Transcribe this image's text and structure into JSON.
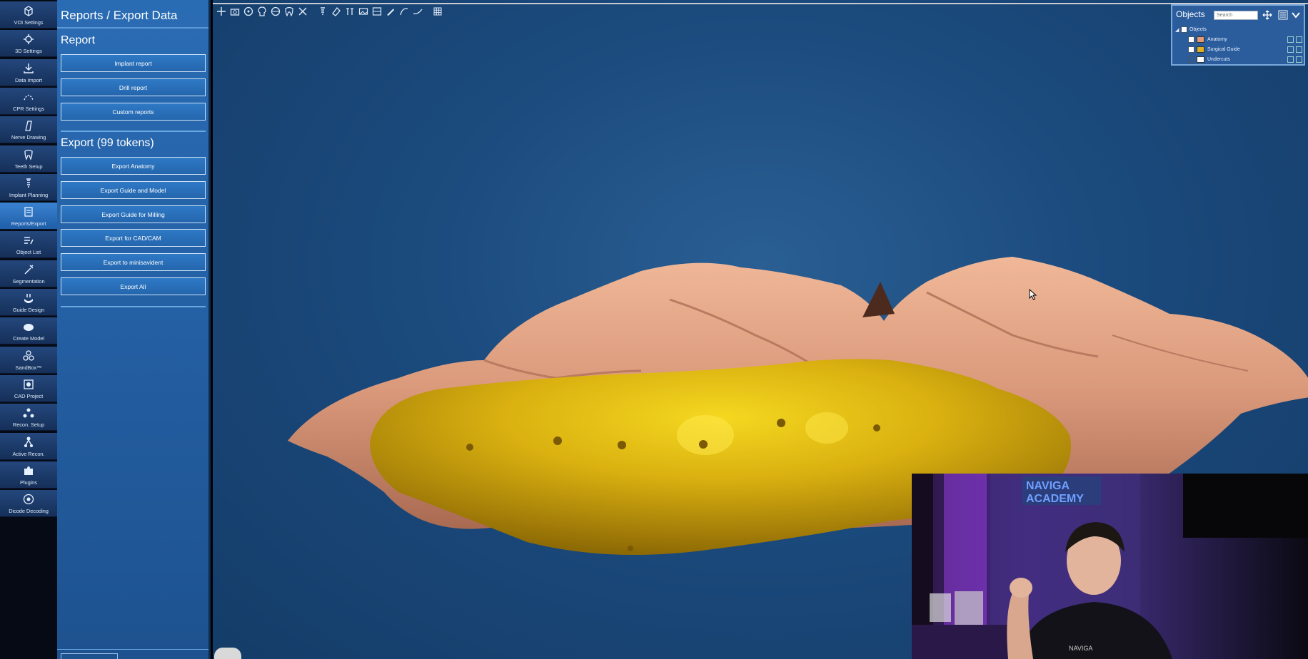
{
  "rail": {
    "items": [
      {
        "label": "VOI Settings",
        "icon": "voi-cube-icon"
      },
      {
        "label": "3D Settings",
        "icon": "3d-settings-icon"
      },
      {
        "label": "Data Import",
        "icon": "download-icon"
      },
      {
        "label": "CPR Settings",
        "icon": "cpr-curve-icon"
      },
      {
        "label": "Nerve Drawing",
        "icon": "nerve-drawing-icon"
      },
      {
        "label": "Teeth Setup",
        "icon": "tooth-icon"
      },
      {
        "label": "Implant Planning",
        "icon": "implant-icon"
      },
      {
        "label": "Reports/Export",
        "icon": "report-icon"
      },
      {
        "label": "Object List",
        "icon": "list-edit-icon"
      },
      {
        "label": "Segmentation",
        "icon": "wand-icon"
      },
      {
        "label": "Guide Design",
        "icon": "guide-icon"
      },
      {
        "label": "Create Model",
        "icon": "model-icon"
      },
      {
        "label": "SandBox™",
        "icon": "sandbox-icon"
      },
      {
        "label": "CAD Project",
        "icon": "cad-icon"
      },
      {
        "label": "Recon. Setup",
        "icon": "recon-setup-icon"
      },
      {
        "label": "Active Recon.",
        "icon": "active-recon-icon"
      },
      {
        "label": "Plugins",
        "icon": "puzzle-icon"
      },
      {
        "label": "Dicode Decoding",
        "icon": "decode-icon"
      }
    ],
    "active_index": 7
  },
  "panel": {
    "title": "Reports / Export Data",
    "report_section": "Report",
    "report_buttons": [
      "Implant report",
      "Drill report",
      "Custom reports"
    ],
    "export_section": "Export (99 tokens)",
    "export_buttons": [
      "Export Anatomy",
      "Export Guide and Model",
      "Export Guide for Milling",
      "Export for CAD/CAM",
      "Export to minisavident",
      "Export All"
    ]
  },
  "toolbar": {
    "tools": [
      "move-icon",
      "camera-icon",
      "radiation-icon",
      "skull-icon",
      "sphere-icon",
      "tooth-outline-icon",
      "close-icon",
      "implant-tool-icon",
      "eraser-icon",
      "measure-icon",
      "panorama-icon",
      "image-icon",
      "knife-icon",
      "curve-icon",
      "line-icon",
      "grid-icon"
    ]
  },
  "objects": {
    "title": "Objects",
    "search_placeholder": "Search",
    "root_label": "Objects",
    "items": [
      {
        "name": "Anatomy",
        "color": "#e49a76",
        "checked": true
      },
      {
        "name": "Surgical Guide",
        "color": "#e0b020",
        "checked": true
      },
      {
        "name": "Undercuts",
        "color": "#ffffff",
        "checked": false
      }
    ]
  },
  "colors": {
    "anatomy": "#d9987a",
    "guide": "#d9b010",
    "panel": "#2a6cb4",
    "viewport": "#1b4a7d"
  },
  "webcam": {
    "sign_text": "NAVIGA ACADEMY",
    "shirt_text": "NAVIGA"
  }
}
